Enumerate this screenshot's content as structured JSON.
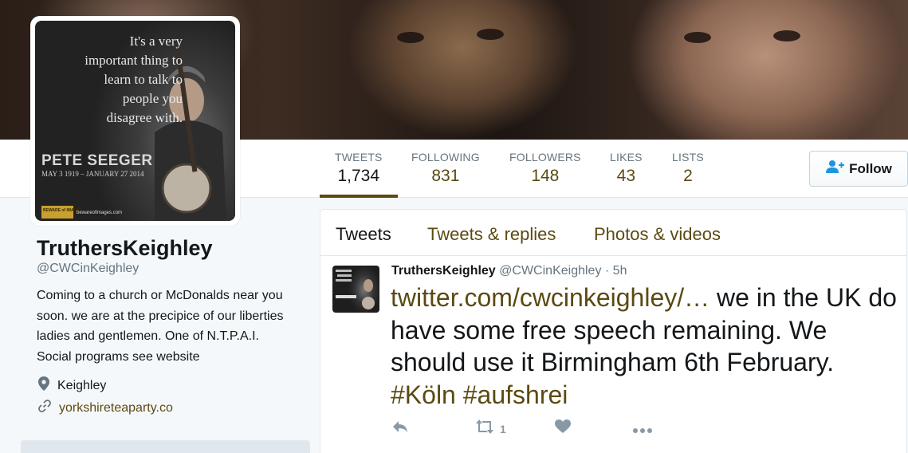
{
  "profile": {
    "avatar_quote": "It's a very important thing to learn to talk to people you disagree with.",
    "avatar_name": "PETE SEEGER",
    "avatar_dates": "MAY 3 1919 – JANUARY 27 2014",
    "avatar_brand": "BEWARE of IMAGES",
    "avatar_url": "bewareofimages.com",
    "name": "TruthersKeighley",
    "handle": "@CWCinKeighley",
    "bio": "Coming to a church or McDonalds near you soon. we are at the precipice of our liberties ladies and gentlemen. One of N.T.P.A.I. Social programs see website",
    "location": "Keighley",
    "website": "yorkshireteaparty.co"
  },
  "nav": {
    "stats": [
      {
        "label": "TWEETS",
        "value": "1,734"
      },
      {
        "label": "FOLLOWING",
        "value": "831"
      },
      {
        "label": "FOLLOWERS",
        "value": "148"
      },
      {
        "label": "LIKES",
        "value": "43"
      },
      {
        "label": "LISTS",
        "value": "2"
      }
    ],
    "follow_label": "Follow"
  },
  "timeline": {
    "tabs": [
      "Tweets",
      "Tweets & replies",
      "Photos & videos"
    ],
    "tweet": {
      "name": "TruthersKeighley",
      "handle": "@CWCinKeighley",
      "sep": "·",
      "time": "5h",
      "link": "twitter.com/cwcinkeighley/…",
      "text": " we in the UK do have some free speech remaining. We should use it Birmingham 6th February. ",
      "hashtags": [
        "#Köln",
        "#aufshrei"
      ],
      "retweet_count": "1"
    }
  },
  "icons": {
    "follow": "person-plus-icon",
    "location": "map-pin-icon",
    "website": "link-icon",
    "reply": "reply-icon",
    "retweet": "retweet-icon",
    "like": "heart-icon",
    "more": "more-dots-icon"
  },
  "colors": {
    "accent": "#5b4a12",
    "muted": "#66757f",
    "text": "#14171a",
    "action": "#8899a6"
  }
}
